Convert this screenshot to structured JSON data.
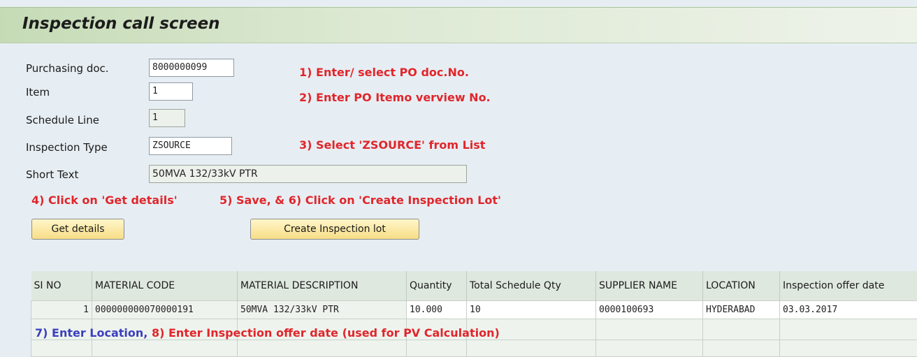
{
  "window": {
    "title": "Inspection call screen"
  },
  "form": {
    "purchasing_doc": {
      "label": "Purchasing doc.",
      "value": "8000000099"
    },
    "item": {
      "label": "Item",
      "value": "1"
    },
    "schedule_line": {
      "label": "Schedule Line",
      "value": "1"
    },
    "inspection_type": {
      "label": "Inspection Type",
      "value": "ZSOURCE"
    },
    "short_text": {
      "label": "Short Text",
      "value": "50MVA 132/33kV PTR"
    }
  },
  "annotations": {
    "step1": "1) Enter/ select PO doc.No.",
    "step2": "2) Enter PO Itemo verview No.",
    "step3": "3) Select 'ZSOURCE' from List",
    "step4": "4) Click on 'Get details'",
    "step56": "5) Save,  & 6) Click on 'Create Inspection Lot'",
    "step7": "7) Enter Location,",
    "step8": "8) Enter Inspection offer date (used for PV Calculation)"
  },
  "buttons": {
    "get_details": "Get details",
    "create_lot": "Create Inspection lot"
  },
  "table": {
    "columns": [
      "SI NO",
      "MATERIAL CODE",
      "MATERIAL DESCRIPTION",
      "Quantity",
      "Total Schedule Qty",
      "SUPPLIER NAME",
      "LOCATION",
      "Inspection offer date"
    ],
    "rows": [
      [
        "1",
        "000000000070000191",
        "50MVA 132/33kV PTR",
        "10.000",
        "10",
        "0000100693",
        "HYDERABAD",
        "03.03.2017"
      ]
    ]
  },
  "colors": {
    "annotation_red": "#e0262b",
    "annotation_blue": "#3b3fbd",
    "button_yellow": "#f7dd87",
    "title_green": "#c5dbb6"
  }
}
